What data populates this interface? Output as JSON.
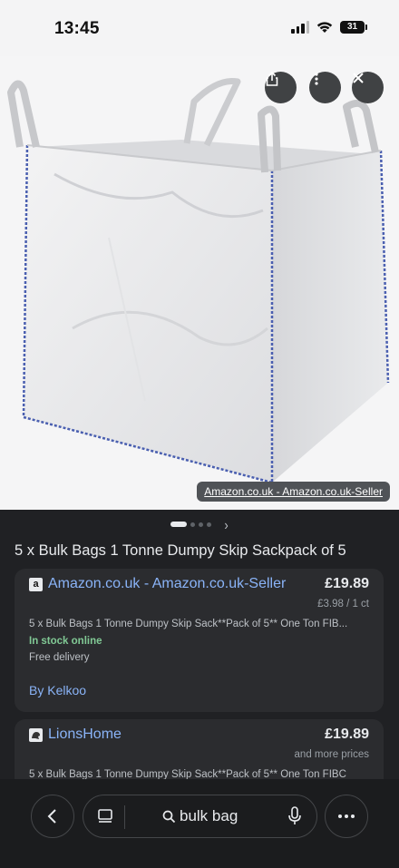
{
  "status_bar": {
    "time": "13:45",
    "battery": "31"
  },
  "hero": {
    "source_tag": "Amazon.co.uk - Amazon.co.uk-Seller",
    "actions": [
      "share-icon",
      "more-vert-icon",
      "close-icon"
    ]
  },
  "carousel": {
    "page_count": 4,
    "active_index": 0
  },
  "result": {
    "title": "5 x Bulk Bags 1 Tonne Dumpy Skip Sackpack of 5"
  },
  "offers": [
    {
      "seller": "Amazon.co.uk - Amazon.co.uk-Seller",
      "seller_icon": "a",
      "price": "£19.89",
      "unit_price": "£3.98 / 1 ct",
      "description": "5 x Bulk Bags 1 Tonne Dumpy Skip Sack**Pack of 5** One Ton FIB...",
      "stock": "In stock online",
      "delivery": "Free delivery",
      "via": "By Kelkoo"
    },
    {
      "seller": "LionsHome",
      "price": "£19.89",
      "more": "and more prices",
      "description": "5 x Bulk Bags 1 Tonne Dumpy Skip Sack**Pack of 5** One Ton FIBC"
    }
  ],
  "bottom_bar": {
    "query": "bulk bag"
  },
  "colors": {
    "link": "#8ab4f8",
    "stock": "#81c995",
    "background": "#202124",
    "card": "#2b2c2f"
  }
}
